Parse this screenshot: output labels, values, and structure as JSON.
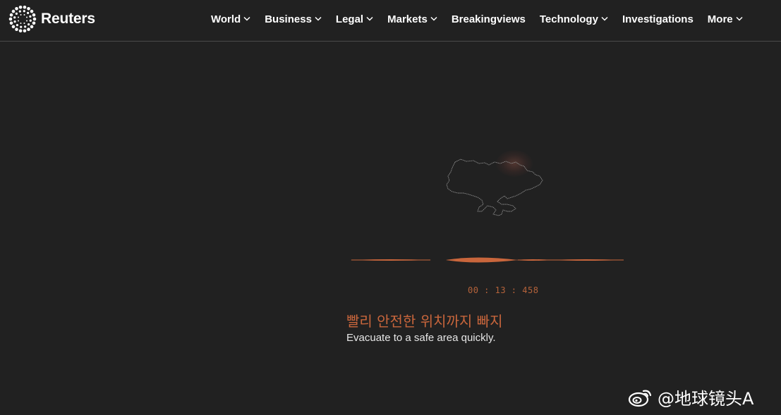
{
  "header": {
    "brand": "Reuters",
    "logo_icon": "reuters-dot-ring-logo",
    "nav": [
      {
        "label": "World",
        "has_dropdown": true
      },
      {
        "label": "Business",
        "has_dropdown": true
      },
      {
        "label": "Legal",
        "has_dropdown": true
      },
      {
        "label": "Markets",
        "has_dropdown": true
      },
      {
        "label": "Breakingviews",
        "has_dropdown": false
      },
      {
        "label": "Technology",
        "has_dropdown": true
      },
      {
        "label": "Investigations",
        "has_dropdown": false
      },
      {
        "label": "More",
        "has_dropdown": true
      }
    ]
  },
  "player": {
    "map_icon": "ukraine-outline-map",
    "timecode": "00 : 13 : 458",
    "subtitle_korean": "빨리 안전한 위치까지 빠지",
    "subtitle_english": "Evacuate to a safe area quickly."
  },
  "watermark": {
    "text": "@地球镜头A",
    "icon": "weibo-icon"
  },
  "colors": {
    "background": "#212121",
    "accent": "#c9663c",
    "text": "#ffffff"
  }
}
